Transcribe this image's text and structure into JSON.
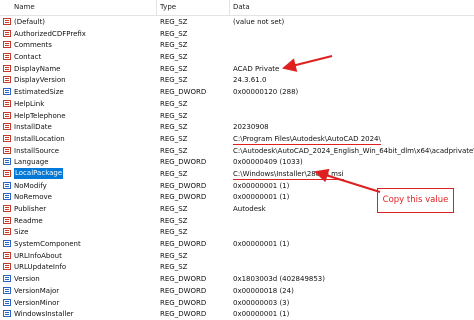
{
  "header": {
    "name": "Name",
    "type": "Type",
    "data": "Data"
  },
  "rows": [
    {
      "name": "(Default)",
      "type": "REG_SZ",
      "data": "(value not set)",
      "icon": "string-value-icon"
    },
    {
      "name": "AuthorizedCDFPrefix",
      "type": "REG_SZ",
      "data": "",
      "icon": "string-value-icon"
    },
    {
      "name": "Comments",
      "type": "REG_SZ",
      "data": "",
      "icon": "string-value-icon"
    },
    {
      "name": "Contact",
      "type": "REG_SZ",
      "data": "",
      "icon": "string-value-icon"
    },
    {
      "name": "DisplayName",
      "type": "REG_SZ",
      "data": "ACAD Private",
      "icon": "string-value-icon"
    },
    {
      "name": "DisplayVersion",
      "type": "REG_SZ",
      "data": "24.3.61.0",
      "icon": "string-value-icon"
    },
    {
      "name": "EstimatedSize",
      "type": "REG_DWORD",
      "data": "0x00000120 (288)",
      "icon": "dword-value-icon"
    },
    {
      "name": "HelpLink",
      "type": "REG_SZ",
      "data": "",
      "icon": "string-value-icon"
    },
    {
      "name": "HelpTelephone",
      "type": "REG_SZ",
      "data": "",
      "icon": "string-value-icon"
    },
    {
      "name": "InstallDate",
      "type": "REG_SZ",
      "data": "20230908",
      "icon": "string-value-icon"
    },
    {
      "name": "InstallLocation",
      "type": "REG_SZ",
      "data": "C:\\Program Files\\Autodesk\\AutoCAD 2024\\",
      "icon": "string-value-icon"
    },
    {
      "name": "InstallSource",
      "type": "REG_SZ",
      "data": "C:\\Autodesk\\AutoCAD_2024_English_Win_64bit_dlm\\x64\\acadprivate\\",
      "icon": "string-value-icon"
    },
    {
      "name": "Language",
      "type": "REG_DWORD",
      "data": "0x00000409 (1033)",
      "icon": "dword-value-icon"
    },
    {
      "name": "LocalPackage",
      "type": "REG_SZ",
      "data": "C:\\Windows\\Installer\\28de6.msi",
      "icon": "string-value-icon"
    },
    {
      "name": "NoModify",
      "type": "REG_DWORD",
      "data": "0x00000001 (1)",
      "icon": "dword-value-icon"
    },
    {
      "name": "NoRemove",
      "type": "REG_DWORD",
      "data": "0x00000001 (1)",
      "icon": "dword-value-icon"
    },
    {
      "name": "Publisher",
      "type": "REG_SZ",
      "data": "Autodesk",
      "icon": "string-value-icon"
    },
    {
      "name": "Readme",
      "type": "REG_SZ",
      "data": "",
      "icon": "string-value-icon"
    },
    {
      "name": "Size",
      "type": "REG_SZ",
      "data": "",
      "icon": "string-value-icon"
    },
    {
      "name": "SystemComponent",
      "type": "REG_DWORD",
      "data": "0x00000001 (1)",
      "icon": "dword-value-icon"
    },
    {
      "name": "URLInfoAbout",
      "type": "REG_SZ",
      "data": "",
      "icon": "string-value-icon"
    },
    {
      "name": "URLUpdateInfo",
      "type": "REG_SZ",
      "data": "",
      "icon": "string-value-icon"
    },
    {
      "name": "Version",
      "type": "REG_DWORD",
      "data": "0x1803003d (402849853)",
      "icon": "dword-value-icon"
    },
    {
      "name": "VersionMajor",
      "type": "REG_DWORD",
      "data": "0x00000018 (24)",
      "icon": "dword-value-icon"
    },
    {
      "name": "VersionMinor",
      "type": "REG_DWORD",
      "data": "0x00000003 (3)",
      "icon": "dword-value-icon"
    },
    {
      "name": "WindowsInstaller",
      "type": "REG_DWORD",
      "data": "0x00000001 (1)",
      "icon": "dword-value-icon"
    }
  ],
  "selected_row": "LocalPackage",
  "callout": {
    "text": "Copy this value"
  },
  "colors": {
    "annotation": "#e02020",
    "selection": "#0078d7",
    "string_icon": "#c23a2a",
    "dword_icon": "#2a63c2"
  }
}
